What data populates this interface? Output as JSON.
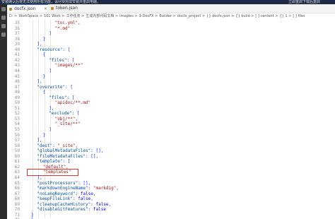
{
  "banner": {
    "message": "安装确认后将无法使用所有功能，请尽快完成安装并重启电脑。",
    "link1": "立即重启",
    "link2": "下载后重启"
  },
  "tabs": [
    {
      "label": "docfx.json",
      "active": true
    },
    {
      "label": "token.json",
      "active": false
    }
  ],
  "breadcrumb": [
    "D:",
    "WorkSpace",
    "101 Work",
    "工作任务",
    "生成内部代码文档",
    "Imaples",
    "3-DocFX",
    "Builder",
    "docfx_project",
    "{} docfx.json",
    "{} build",
    "[ ] content",
    "{} 1",
    "[ ] files"
  ],
  "editor": {
    "lines": [
      {
        "n": "35",
        "indent": 4,
        "tokens": [
          {
            "t": "\"toc.yml\",",
            "c": "str"
          }
        ]
      },
      {
        "n": "36",
        "indent": 4,
        "tokens": [
          {
            "t": "\"*.md\"",
            "c": "str"
          }
        ]
      },
      {
        "n": "37",
        "indent": 3,
        "tokens": [
          {
            "t": "]",
            "c": "pn"
          }
        ]
      },
      {
        "n": "38",
        "indent": 2,
        "tokens": [
          {
            "t": "}",
            "c": "pn"
          }
        ]
      },
      {
        "n": "39",
        "indent": 1,
        "tokens": [
          {
            "t": "],",
            "c": "pn"
          }
        ]
      },
      {
        "n": "40",
        "indent": 1,
        "tokens": [
          {
            "t": "\"resource\"",
            "c": "key"
          },
          {
            "t": ": [",
            "c": "pn"
          }
        ]
      },
      {
        "n": "41",
        "indent": 2,
        "tokens": [
          {
            "t": "{",
            "c": "pn"
          }
        ]
      },
      {
        "n": "42",
        "indent": 3,
        "tokens": [
          {
            "t": "\"files\"",
            "c": "key"
          },
          {
            "t": ": [",
            "c": "pn"
          }
        ]
      },
      {
        "n": "43",
        "indent": 4,
        "tokens": [
          {
            "t": "\"images/**\"",
            "c": "str"
          }
        ]
      },
      {
        "n": "44",
        "indent": 3,
        "tokens": [
          {
            "t": "]",
            "c": "pn"
          }
        ]
      },
      {
        "n": "45",
        "indent": 2,
        "tokens": [
          {
            "t": "}",
            "c": "pn"
          }
        ]
      },
      {
        "n": "46",
        "indent": 1,
        "tokens": [
          {
            "t": "],",
            "c": "pn"
          }
        ]
      },
      {
        "n": "47",
        "indent": 1,
        "tokens": [
          {
            "t": "\"overwrite\"",
            "c": "key"
          },
          {
            "t": ": [",
            "c": "pn"
          }
        ]
      },
      {
        "n": "48",
        "indent": 2,
        "tokens": [
          {
            "t": "{",
            "c": "pn"
          }
        ]
      },
      {
        "n": "49",
        "indent": 3,
        "tokens": [
          {
            "t": "\"files\"",
            "c": "key"
          },
          {
            "t": ": [",
            "c": "pn"
          }
        ]
      },
      {
        "n": "50",
        "indent": 4,
        "tokens": [
          {
            "t": "\"apidoc/**.md\"",
            "c": "str"
          }
        ]
      },
      {
        "n": "51",
        "indent": 3,
        "tokens": [
          {
            "t": "],",
            "c": "pn"
          }
        ]
      },
      {
        "n": "52",
        "indent": 3,
        "tokens": [
          {
            "t": "\"exclude\"",
            "c": "key"
          },
          {
            "t": ": [",
            "c": "pn"
          }
        ]
      },
      {
        "n": "53",
        "indent": 4,
        "tokens": [
          {
            "t": "\"obj/**\",",
            "c": "str"
          }
        ]
      },
      {
        "n": "54",
        "indent": 4,
        "tokens": [
          {
            "t": "\"_site/**\"",
            "c": "str"
          }
        ]
      },
      {
        "n": "55",
        "indent": 3,
        "tokens": [
          {
            "t": "]",
            "c": "pn"
          }
        ]
      },
      {
        "n": "56",
        "indent": 2,
        "tokens": [
          {
            "t": "}",
            "c": "pn"
          }
        ]
      },
      {
        "n": "57",
        "indent": 1,
        "tokens": [
          {
            "t": "],",
            "c": "pn"
          }
        ]
      },
      {
        "n": "58",
        "indent": 1,
        "tokens": [
          {
            "t": "\"dest\"",
            "c": "key"
          },
          {
            "t": ": ",
            "c": "pn"
          },
          {
            "t": "\"_site\"",
            "c": "str"
          },
          {
            "t": ",",
            "c": "pn"
          }
        ]
      },
      {
        "n": "59",
        "indent": 1,
        "tokens": [
          {
            "t": "\"globalMetadataFiles\"",
            "c": "key"
          },
          {
            "t": ": [],",
            "c": "pn"
          }
        ]
      },
      {
        "n": "60",
        "indent": 1,
        "tokens": [
          {
            "t": "\"fileMetadataFiles\"",
            "c": "key"
          },
          {
            "t": ": [],",
            "c": "pn"
          }
        ]
      },
      {
        "n": "61",
        "indent": 1,
        "tokens": [
          {
            "t": "\"template\"",
            "c": "key"
          },
          {
            "t": ": [",
            "c": "pn"
          }
        ]
      },
      {
        "n": "62",
        "indent": 2,
        "tokens": [
          {
            "t": "\"default\",",
            "c": "str"
          }
        ]
      },
      {
        "n": "63",
        "indent": 2,
        "tokens": [
          {
            "t": "\"templates\"",
            "c": "str"
          }
        ]
      },
      {
        "n": "64",
        "indent": 1,
        "tokens": [
          {
            "t": "],",
            "c": "pn"
          }
        ]
      },
      {
        "n": "65",
        "indent": 1,
        "tokens": [
          {
            "t": "\"postProcessors\"",
            "c": "key"
          },
          {
            "t": ": [],",
            "c": "pn"
          }
        ]
      },
      {
        "n": "66",
        "indent": 1,
        "tokens": [
          {
            "t": "\"markdownEngineName\"",
            "c": "key"
          },
          {
            "t": ": ",
            "c": "pn"
          },
          {
            "t": "\"markdig\"",
            "c": "str"
          },
          {
            "t": ",",
            "c": "pn"
          }
        ]
      },
      {
        "n": "67",
        "indent": 1,
        "tokens": [
          {
            "t": "\"noLangKeyword\"",
            "c": "key"
          },
          {
            "t": ": ",
            "c": "pn"
          },
          {
            "t": "false",
            "c": "kw"
          },
          {
            "t": ",",
            "c": "pn"
          }
        ]
      },
      {
        "n": "68",
        "indent": 1,
        "tokens": [
          {
            "t": "\"keepFileLink\"",
            "c": "key"
          },
          {
            "t": ": ",
            "c": "pn"
          },
          {
            "t": "false",
            "c": "kw"
          },
          {
            "t": ",",
            "c": "pn"
          }
        ]
      },
      {
        "n": "69",
        "indent": 1,
        "tokens": [
          {
            "t": "\"cleanupCacheHistory\"",
            "c": "key"
          },
          {
            "t": ": ",
            "c": "pn"
          },
          {
            "t": "false",
            "c": "kw"
          },
          {
            "t": ",",
            "c": "pn"
          }
        ]
      },
      {
        "n": "70",
        "indent": 1,
        "tokens": [
          {
            "t": "\"disableGitFeatures\"",
            "c": "key"
          },
          {
            "t": ": ",
            "c": "pn"
          },
          {
            "t": "false",
            "c": "kw"
          }
        ]
      },
      {
        "n": "71",
        "indent": 0,
        "tokens": [
          {
            "t": "}",
            "c": "pn"
          }
        ]
      },
      {
        "n": "72",
        "indent": 0,
        "tokens": [
          {
            "t": "}",
            "c": "pn"
          }
        ]
      }
    ],
    "highlight_line": "63"
  },
  "colors": {
    "tab_accent": "#3d7bd6",
    "highlight_box": "#e0352b",
    "activity_bar": "#2c2c2c"
  }
}
